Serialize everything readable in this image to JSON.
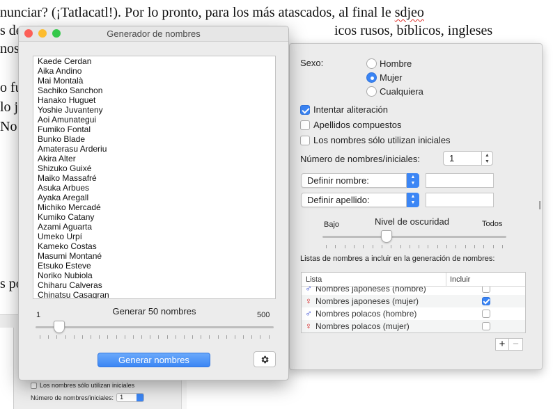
{
  "document": {
    "lines": [
      {
        "text": "nunciar? (¡Tatlacatl!). Por lo pronto, para los más atascados, al final le ",
        "squiggle": "sdjeo"
      },
      {
        "text": "s de",
        "tail": "icos rusos, bíblicos, ingleses"
      },
      {
        "text": "nos"
      },
      {
        "text": "o fu"
      },
      {
        "text": "lo j"
      },
      {
        "text": "No"
      },
      {
        "text": "s po"
      }
    ]
  },
  "behind_window": {
    "checkbox_label": "Los nombres sólo utilizan iniciales",
    "count_label": "Número de nombres/iniciales:",
    "count_value": "1"
  },
  "options_panel": {
    "sex_label": "Sexo:",
    "sex_options": [
      {
        "label": "Hombre",
        "selected": false
      },
      {
        "label": "Mujer",
        "selected": true
      },
      {
        "label": "Cualquiera",
        "selected": false
      }
    ],
    "checkboxes": [
      {
        "label": "Intentar aliteración",
        "checked": true
      },
      {
        "label": "Apellidos compuestos",
        "checked": false
      },
      {
        "label": "Los nombres sólo utilizan iniciales",
        "checked": false
      }
    ],
    "count_label": "Número de nombres/iniciales:",
    "count_value": "1",
    "first_name_popup": "Definir nombre:",
    "last_name_popup": "Definir apellido:",
    "darkness": {
      "title": "Nivel de oscuridad",
      "min_label": "Bajo",
      "max_label": "Todos",
      "value_fraction": 0.35
    },
    "lists_caption": "Listas de nombres a incluir en la generación de nombres:",
    "table": {
      "col_list": "Lista",
      "col_include": "Incluir",
      "rows": [
        {
          "symbol": "♂",
          "symbol_color": "#2a3fd0",
          "name": "Nombres japoneses (hombre)",
          "include": false
        },
        {
          "symbol": "♀",
          "symbol_color": "#d42020",
          "name": "Nombres japoneses (mujer)",
          "include": true
        },
        {
          "symbol": "♂",
          "symbol_color": "#2a3fd0",
          "name": "Nombres polacos (hombre)",
          "include": false
        },
        {
          "symbol": "♀",
          "symbol_color": "#d42020",
          "name": "Nombres polacos (mujer)",
          "include": false
        }
      ]
    },
    "add_label": "+",
    "remove_label": "−"
  },
  "generator": {
    "title": "Generador de nombres",
    "names": [
      "Kaede Cerdan",
      "Aika Andino",
      "Mai Montalà",
      "Sachiko Sanchon",
      "Hanako Huguet",
      "Yoshie Juvanteny",
      "Aoi Amunategui",
      "Fumiko Fontal",
      "Bunko Blade",
      "Amaterasu Arderiu",
      "Akira Alter",
      "Shizuko Guixé",
      "Maiko Massafré",
      "Asuka Arbues",
      "Ayaka Aregall",
      "Michiko Mercadé",
      "Kumiko Catany",
      "Azami Aguarta",
      "Umeko Urpí",
      "Kameko Costas",
      "Masumi Montané",
      "Etsuko Esteve",
      "Noriko Nubiola",
      "Chiharu Calveras",
      "Chinatsu Casagran"
    ],
    "count_caption": "Generar 50 nombres",
    "slider_min": "1",
    "slider_max": "500",
    "slider_value_fraction": 0.1,
    "generate_button": "Generar nombres",
    "traffic_lights": {
      "close": "#fc5f57",
      "minimize": "#fdbc2e",
      "zoom": "#34c84a"
    }
  }
}
